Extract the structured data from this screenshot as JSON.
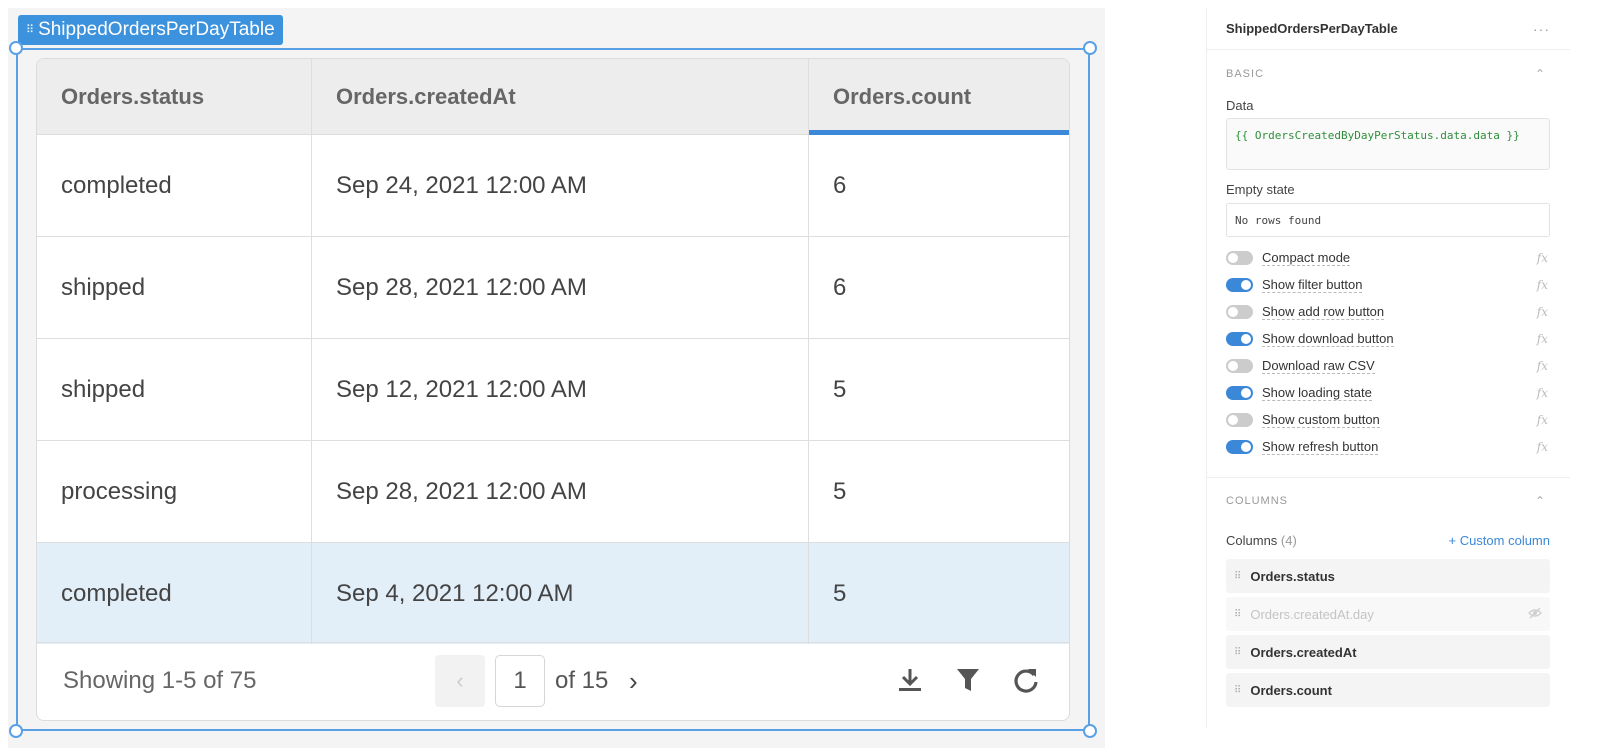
{
  "component": {
    "name": "ShippedOrdersPerDayTable"
  },
  "table": {
    "columns": [
      "Orders.status",
      "Orders.createdAt",
      "Orders.count"
    ],
    "sorted_column": "Orders.count",
    "rows": [
      [
        "completed",
        "Sep 24, 2021 12:00 AM",
        "6"
      ],
      [
        "shipped",
        "Sep 28, 2021 12:00 AM",
        "6"
      ],
      [
        "shipped",
        "Sep 12, 2021 12:00 AM",
        "5"
      ],
      [
        "processing",
        "Sep 28, 2021 12:00 AM",
        "5"
      ],
      [
        "completed",
        "Sep 4, 2021 12:00 AM",
        "5"
      ]
    ],
    "selected_row": 4,
    "footer": {
      "showing": "Showing 1-5 of 75",
      "page": "1",
      "of_pages": "of 15",
      "prev_icon": "chevron-left-icon",
      "next_icon": "chevron-right-icon",
      "action_icons": [
        "download-icon",
        "filter-icon",
        "refresh-icon"
      ]
    }
  },
  "inspector": {
    "title": "ShippedOrdersPerDayTable",
    "more_label": "···",
    "basic_section": "BASIC",
    "data_label": "Data",
    "data_value": "{{ OrdersCreatedByDayPerStatus.data.data }}",
    "empty_state_label": "Empty state",
    "empty_state_value": "No rows found",
    "fx_label": "fx",
    "toggles": [
      {
        "label": "Compact mode",
        "on": false
      },
      {
        "label": "Show filter button",
        "on": true
      },
      {
        "label": "Show add row button",
        "on": false
      },
      {
        "label": "Show download button",
        "on": true
      },
      {
        "label": "Download raw CSV",
        "on": false
      },
      {
        "label": "Show loading state",
        "on": true
      },
      {
        "label": "Show custom button",
        "on": false
      },
      {
        "label": "Show refresh button",
        "on": true
      }
    ],
    "columns_section": "COLUMNS",
    "columns_label": "Columns",
    "columns_count": "(4)",
    "custom_column_label": "+ Custom column",
    "columns": [
      {
        "name": "Orders.status",
        "hidden": false
      },
      {
        "name": "Orders.createdAt.day",
        "hidden": true
      },
      {
        "name": "Orders.createdAt",
        "hidden": false
      },
      {
        "name": "Orders.count",
        "hidden": false
      }
    ]
  },
  "colors": {
    "accent": "#3c88d8",
    "selected_row": "#e2eef8",
    "code_text": "#2f8f3a"
  }
}
